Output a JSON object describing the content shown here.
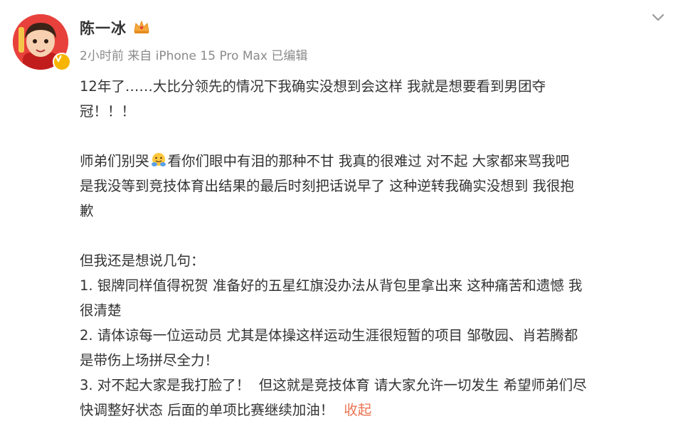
{
  "post": {
    "author": "陈一冰",
    "meta": "2小时前  来自 iPhone 15 Pro Max 已编辑",
    "collapse_label": "收起",
    "emoji_name": "hugging-face-emoji",
    "lines": {
      "l1": "12年了……大比分领先的情况下我确实没想到会这样 我就是想要看到男团夺",
      "l2": "冠！！！",
      "l3a": "师弟们别哭",
      "l3b": "看你们眼中有泪的那种不甘 我真的很难过 对不起 大家都来骂我吧",
      "l4": "是我没等到竞技体育出结果的最后时刻把话说早了 这种逆转我确实没想到 我很抱",
      "l5": "歉",
      "l6": "但我还是想说几句：",
      "l7": "1. 银牌同样值得祝贺 准备好的五星红旗没办法从背包里拿出来 这种痛苦和遗憾 我",
      "l8": "很清楚",
      "l9": "2. 请体谅每一位运动员 尤其是体操这样运动生涯很短暂的项目 邹敬园、肖若腾都",
      "l10": "是带伤上场拼尽全力！",
      "l11": "3. 对不起大家是我打脸了！  但这就是竞技体育 请大家允许一切发生 希望师弟们尽",
      "l12": "快调整好状态 后面的单项比赛继续加油！"
    }
  },
  "icons": {
    "avatar": "avatar-cartoon",
    "verified": "verified-v-icon",
    "crown": "crown-icon",
    "chevron": "chevron-down-icon"
  },
  "colors": {
    "text": "#333333",
    "meta": "#8a8a8a",
    "link": "#eb7350",
    "avatar_bg": "#e8413c",
    "verified_badge": "#f7b500"
  }
}
